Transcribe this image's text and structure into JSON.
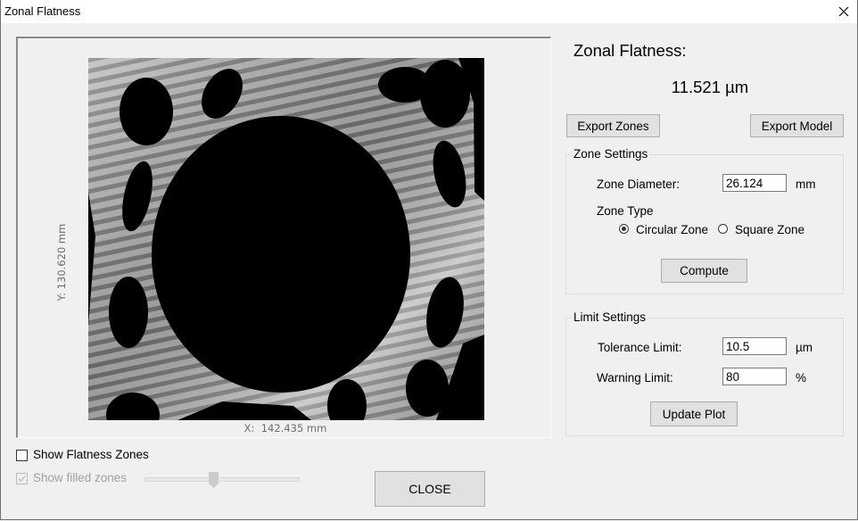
{
  "window": {
    "title": "Zonal Flatness",
    "close_icon": "close-icon"
  },
  "image_panel": {
    "x_label": "X:  142.435 mm",
    "y_label": "Y:  130.620 mm"
  },
  "result": {
    "title": "Zonal Flatness:",
    "value": "11.521 µm"
  },
  "toolbar": {
    "export_zones_label": "Export Zones",
    "export_model_label": "Export Model"
  },
  "zone_settings": {
    "legend": "Zone Settings",
    "diameter_label": "Zone Diameter:",
    "diameter_value": "26.124",
    "diameter_unit": "mm",
    "zone_type_label": "Zone Type",
    "zone_types": [
      {
        "label": "Circular Zone",
        "checked": true
      },
      {
        "label": "Square Zone",
        "checked": false
      }
    ],
    "compute_label": "Compute"
  },
  "limit_settings": {
    "legend": "Limit Settings",
    "tolerance_label": "Tolerance Limit:",
    "tolerance_value": "10.5",
    "tolerance_unit": "µm",
    "warning_label": "Warning Limit:",
    "warning_value": "80",
    "warning_unit": "%",
    "update_label": "Update Plot"
  },
  "bottom": {
    "show_zones_label": "Show Flatness Zones",
    "show_zones_checked": false,
    "show_filled_label": "Show filled zones",
    "show_filled_checked": true,
    "show_filled_disabled": true,
    "fill_slider_fraction": 0.45,
    "close_label": "CLOSE"
  }
}
